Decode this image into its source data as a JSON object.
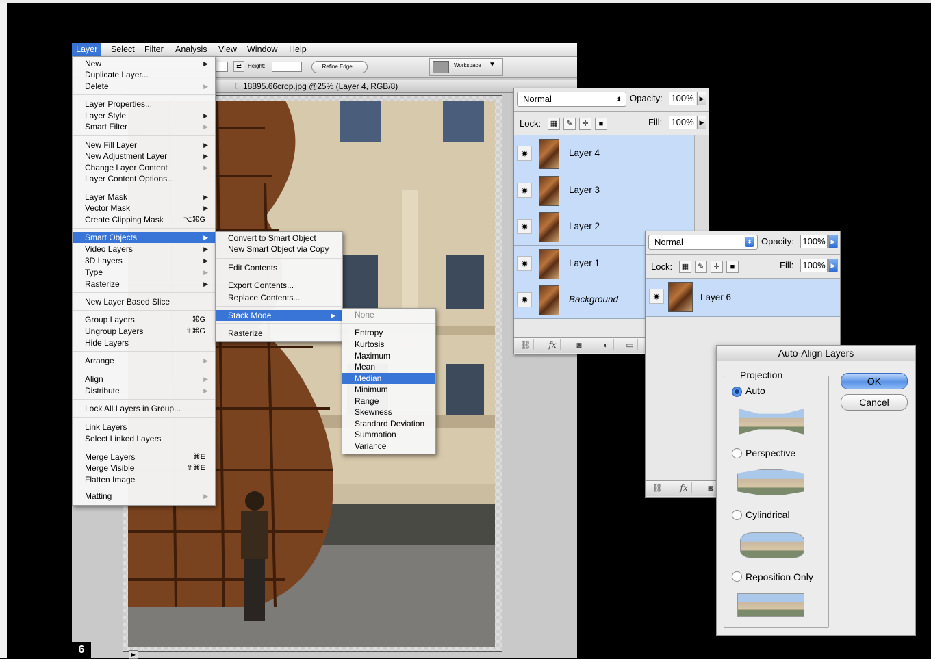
{
  "menubar": {
    "items": [
      "Layer",
      "Select",
      "Filter",
      "Analysis",
      "View",
      "Window",
      "Help"
    ]
  },
  "options_bar": {
    "height_label": "Height:",
    "refine_edge": "Refine Edge...",
    "workspace": "Workspace"
  },
  "document": {
    "title": "18895.66crop.jpg @25% (Layer 4, RGB/8)"
  },
  "page_number": "6",
  "layer_menu": {
    "items": [
      {
        "label": "New",
        "submenu": true
      },
      {
        "label": "Duplicate Layer..."
      },
      {
        "label": "Delete",
        "submenu": true,
        "dim": true
      },
      {
        "label": "Layer Properties..."
      },
      {
        "label": "Layer Style",
        "submenu": true
      },
      {
        "label": "Smart Filter",
        "submenu": true,
        "dim": true
      },
      {
        "label": "New Fill Layer",
        "submenu": true
      },
      {
        "label": "New Adjustment Layer",
        "submenu": true
      },
      {
        "label": "Change Layer Content",
        "submenu": true,
        "dim": true
      },
      {
        "label": "Layer Content Options..."
      },
      {
        "label": "Layer Mask",
        "submenu": true
      },
      {
        "label": "Vector Mask",
        "submenu": true
      },
      {
        "label": "Create Clipping Mask",
        "shortcut": "⌥⌘G"
      },
      {
        "label": "Smart Objects",
        "submenu": true,
        "highlighted": true
      },
      {
        "label": "Video Layers",
        "submenu": true
      },
      {
        "label": "3D Layers",
        "submenu": true
      },
      {
        "label": "Type",
        "submenu": true,
        "dim": true
      },
      {
        "label": "Rasterize",
        "submenu": true
      },
      {
        "label": "New Layer Based Slice"
      },
      {
        "label": "Group Layers",
        "shortcut": "⌘G"
      },
      {
        "label": "Ungroup Layers",
        "shortcut": "⇧⌘G"
      },
      {
        "label": "Hide Layers"
      },
      {
        "label": "Arrange",
        "submenu": true,
        "dim": true
      },
      {
        "label": "Align",
        "submenu": true,
        "dim": true
      },
      {
        "label": "Distribute",
        "submenu": true,
        "dim": true
      },
      {
        "label": "Lock All Layers in Group..."
      },
      {
        "label": "Link Layers"
      },
      {
        "label": "Select Linked Layers"
      },
      {
        "label": "Merge Layers",
        "shortcut": "⌘E"
      },
      {
        "label": "Merge Visible",
        "shortcut": "⇧⌘E"
      },
      {
        "label": "Flatten Image"
      },
      {
        "label": "Matting",
        "submenu": true,
        "dim": true
      }
    ]
  },
  "smart_objects_menu": {
    "items": [
      {
        "label": "Convert to Smart Object"
      },
      {
        "label": "New Smart Object via Copy"
      },
      {
        "label": "Edit Contents"
      },
      {
        "label": "Export Contents..."
      },
      {
        "label": "Replace Contents..."
      },
      {
        "label": "Stack Mode",
        "submenu": true,
        "highlighted": true
      },
      {
        "label": "Rasterize"
      }
    ]
  },
  "stack_mode_menu": {
    "items": [
      {
        "label": "None",
        "dim": true
      },
      {
        "label": "Entropy"
      },
      {
        "label": "Kurtosis"
      },
      {
        "label": "Maximum"
      },
      {
        "label": "Mean"
      },
      {
        "label": "Median",
        "highlighted": true
      },
      {
        "label": "Minimum"
      },
      {
        "label": "Range"
      },
      {
        "label": "Skewness"
      },
      {
        "label": "Standard Deviation"
      },
      {
        "label": "Summation"
      },
      {
        "label": "Variance"
      }
    ]
  },
  "layers_panel_1": {
    "blend_mode": "Normal",
    "opacity_label": "Opacity:",
    "opacity": "100%",
    "lock_label": "Lock:",
    "fill_label": "Fill:",
    "fill": "100%",
    "layers": [
      "Layer 4",
      "Layer 3",
      "Layer 2",
      "Layer 1",
      "Background"
    ],
    "footer": [
      "link-icon",
      "fx-icon",
      "mask-icon",
      "adjustment-icon",
      "folder-icon"
    ]
  },
  "layers_panel_2": {
    "blend_mode": "Normal",
    "opacity_label": "Opacity:",
    "opacity": "100%",
    "lock_label": "Lock:",
    "fill_label": "Fill:",
    "fill": "100%",
    "layers": [
      "Layer 6"
    ]
  },
  "auto_align_dialog": {
    "title": "Auto-Align Layers",
    "group_label": "Projection",
    "options": [
      "Auto",
      "Perspective",
      "Cylindrical",
      "Reposition Only"
    ],
    "selected": "Auto",
    "ok": "OK",
    "cancel": "Cancel"
  }
}
